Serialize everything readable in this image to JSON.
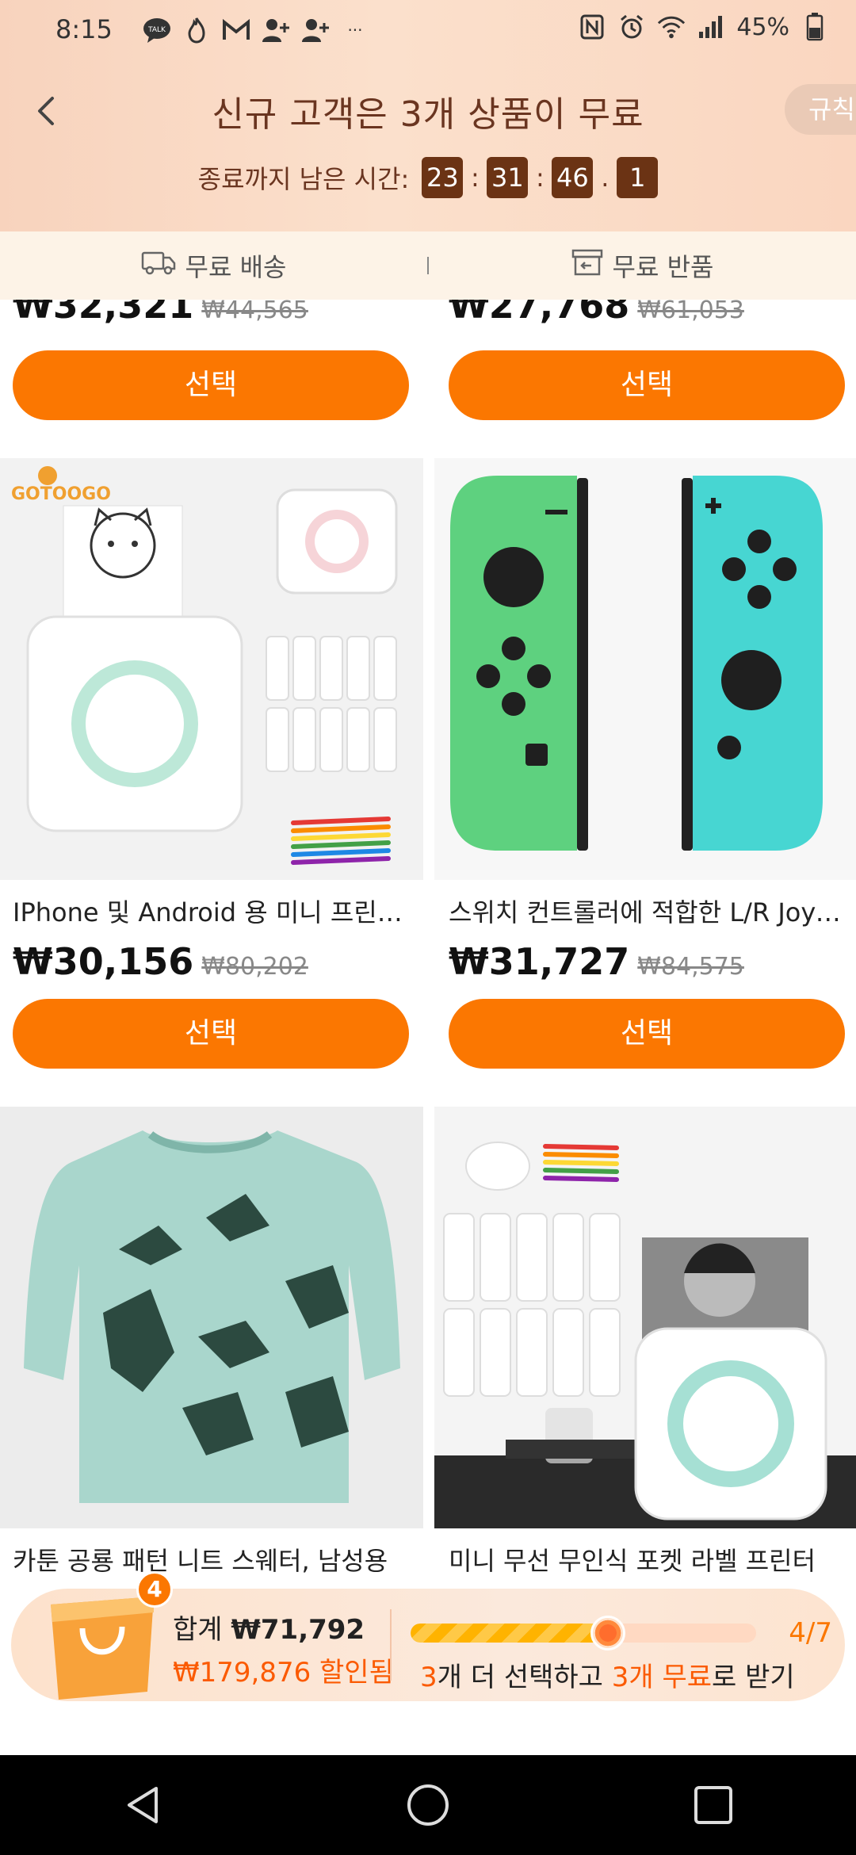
{
  "status_bar": {
    "time": "8:15",
    "battery": "45%",
    "talk_badge": "TALK"
  },
  "header": {
    "title": "신규 고객은 3개 상품이 무료",
    "rules": "규칙",
    "countdown_label": "종료까지 남은 시간:",
    "countdown": {
      "hours": "23",
      "minutes": "31",
      "seconds": "46",
      "tenths": "1"
    }
  },
  "benefits": {
    "free_shipping": "무료 배송",
    "free_return": "무료 반품"
  },
  "products": [
    {
      "title": "",
      "price": "₩32,321",
      "old_price": "₩44,565",
      "button": "선택"
    },
    {
      "title": "",
      "price": "₩27,768",
      "old_price": "₩61,053",
      "button": "선택"
    },
    {
      "title": "IPhone 및 Android 용 미니 프린터 휴대용",
      "price": "₩30,156",
      "old_price": "₩80,202",
      "button": "선택",
      "brand": "GOTOOGO"
    },
    {
      "title": "스위치 컨트롤러에 적합한 L/R Joy-Con",
      "price": "₩31,727",
      "old_price": "₩84,575",
      "button": "선택"
    },
    {
      "title": "카툰 공룡 패턴 니트 스웨터, 남성용",
      "price": "",
      "old_price": "",
      "button": ""
    },
    {
      "title": "미니 무선 무인식 포켓 라벨 프린터",
      "price": "",
      "old_price": "",
      "button": ""
    }
  ],
  "cart": {
    "count": "4",
    "total_label": "합계",
    "total": "₩71,792",
    "discount": "₩179,876 할인됨",
    "progress_text": "4/7",
    "progress_fraction": 0.57,
    "hint_num1": "3",
    "hint_mid": "개 더 선택하고 ",
    "hint_num2": "3개 무료",
    "hint_end": "로 받기"
  },
  "colors": {
    "accent": "#fb7701",
    "header_bg": "#fbe0cc",
    "countdown_box": "#6b3314"
  }
}
